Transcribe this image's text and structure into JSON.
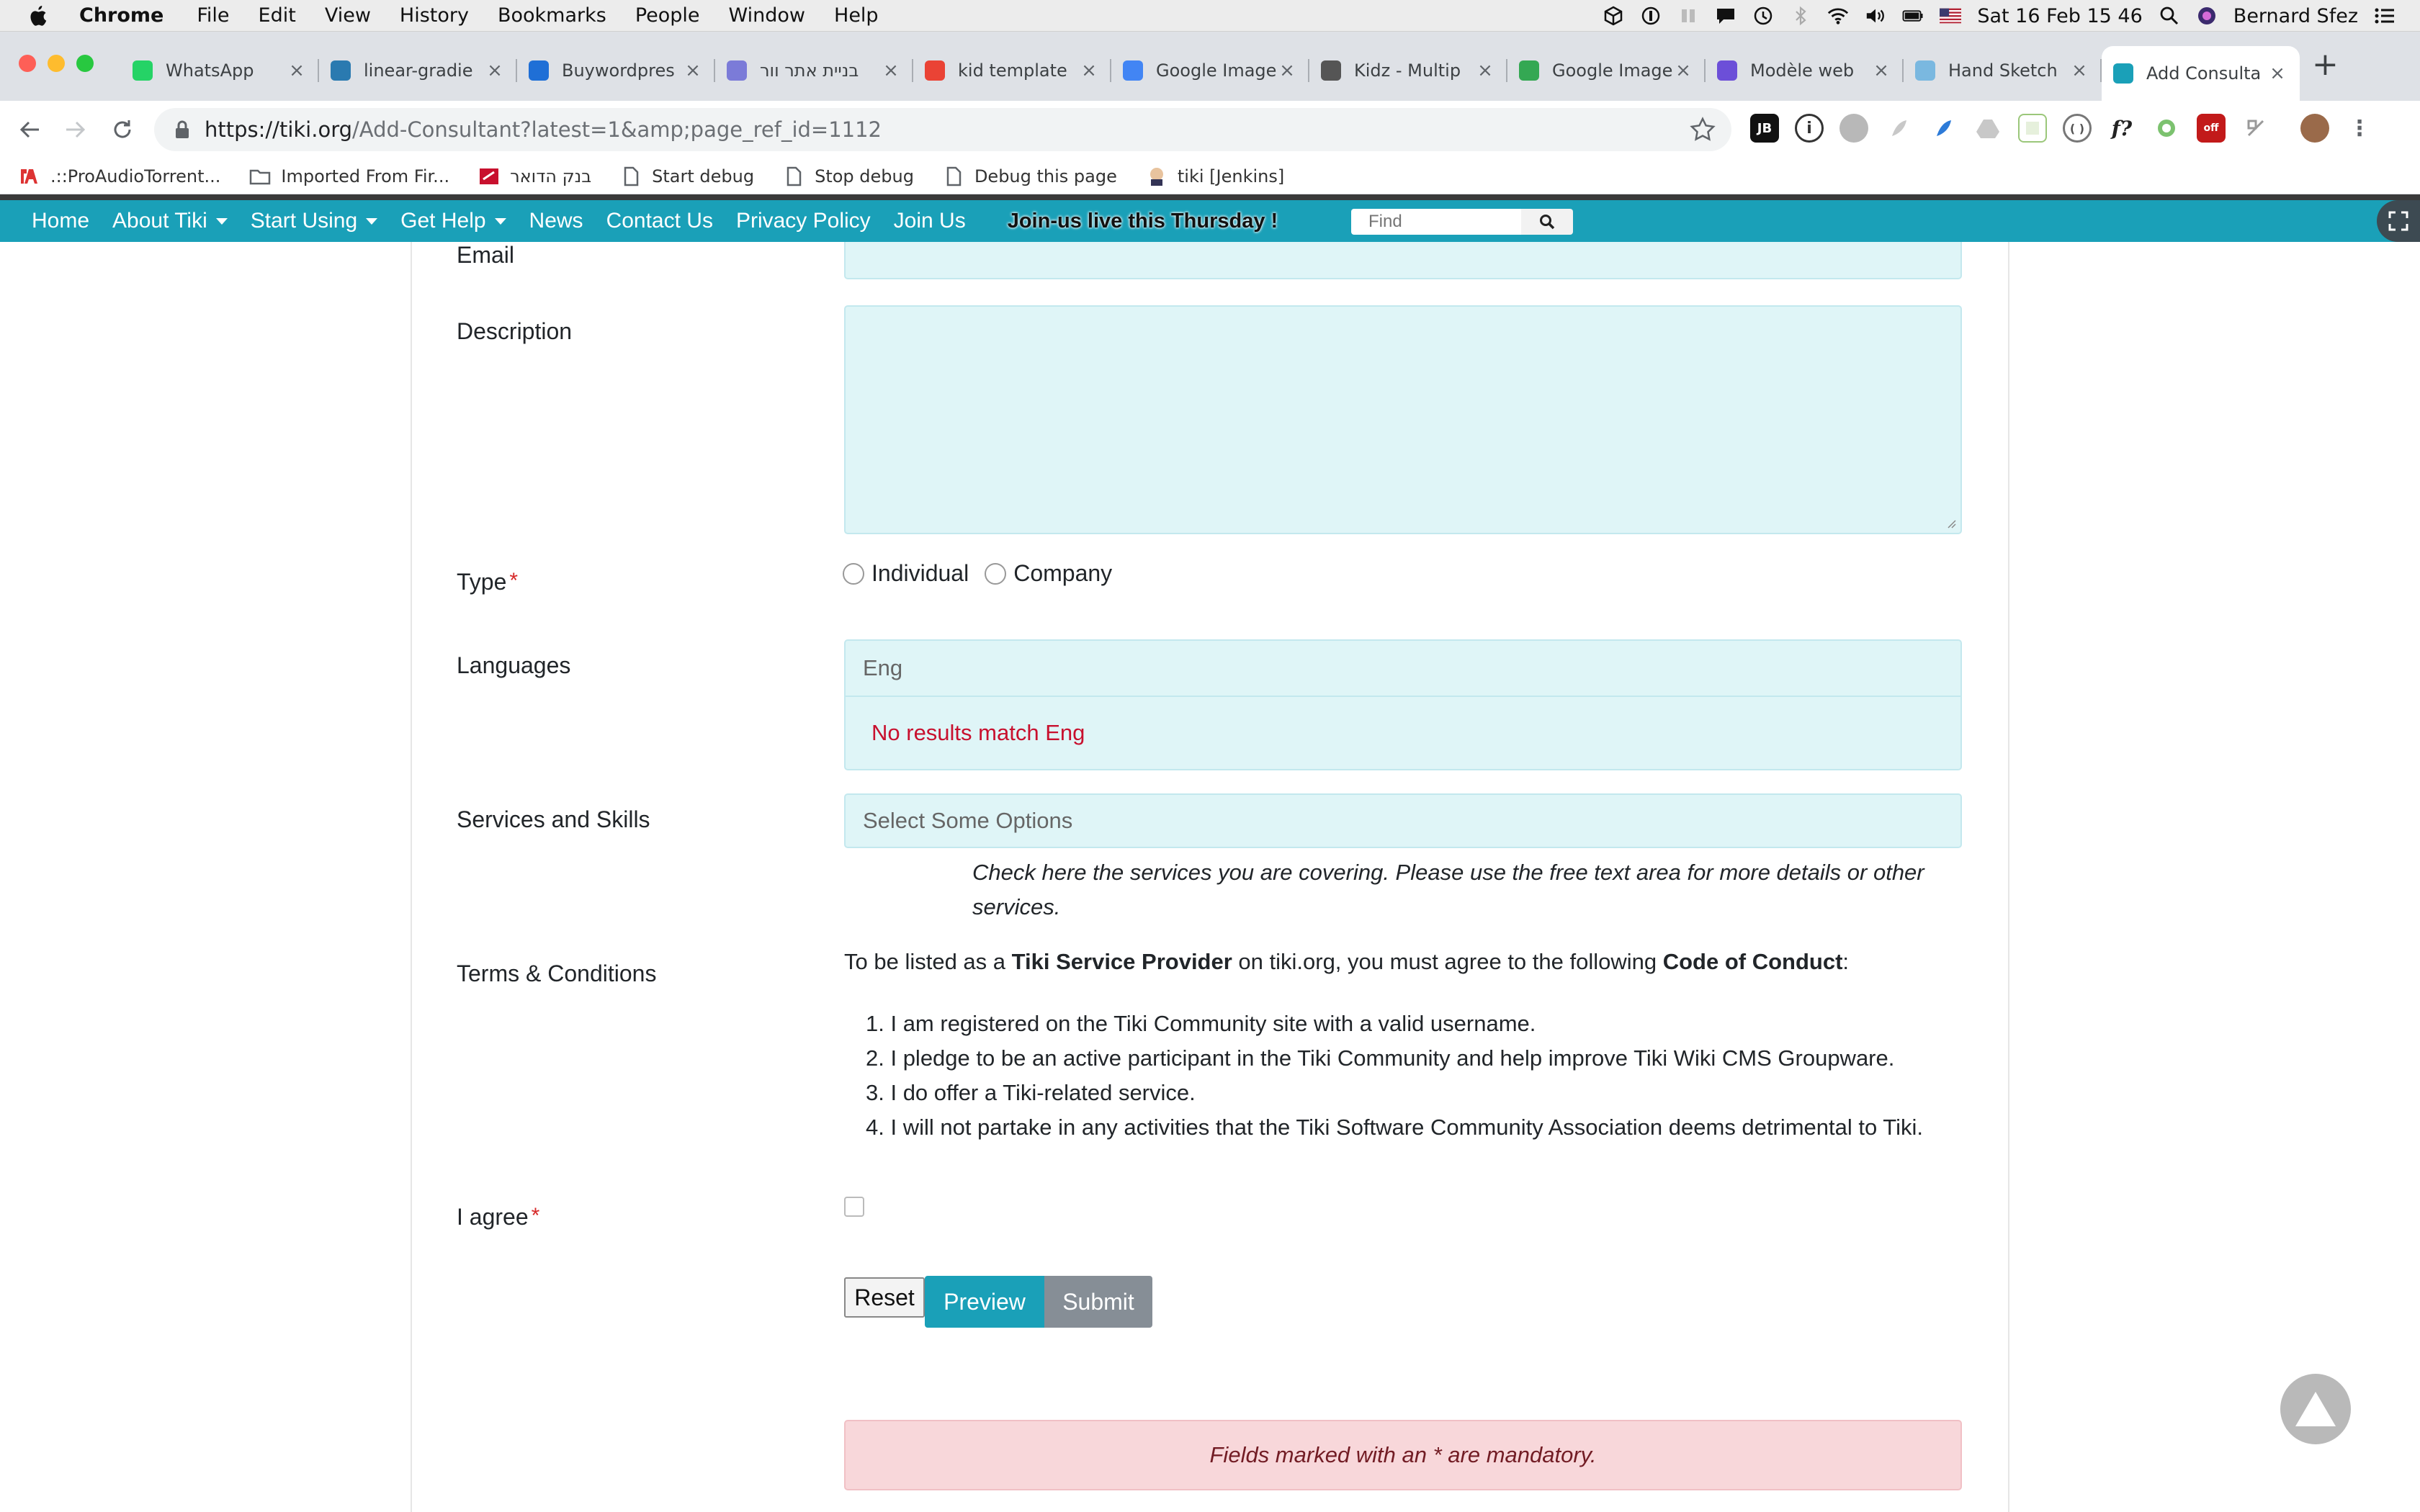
{
  "mac_menubar": {
    "app_name": "Chrome",
    "menus": [
      "File",
      "Edit",
      "View",
      "History",
      "Bookmarks",
      "People",
      "Window",
      "Help"
    ],
    "datetime": "Sat 16 Feb  15 46",
    "user": "Bernard Sfez"
  },
  "browser": {
    "tabs": [
      {
        "title": "WhatsApp",
        "icon": "whatsapp-icon",
        "color": "#25d366"
      },
      {
        "title": "linear-gradie",
        "icon": "site-icon",
        "color": "#2a7ab0"
      },
      {
        "title": "Buywordpres",
        "icon": "feather-icon",
        "color": "#1f6fd6"
      },
      {
        "title": "בניית אתר וור",
        "icon": "rocket-icon",
        "color": "#7b7bd8"
      },
      {
        "title": "kid template",
        "icon": "google-icon",
        "color": "#ea4335"
      },
      {
        "title": "Google Image",
        "icon": "google-icon",
        "color": "#4285f4"
      },
      {
        "title": "Kidz - Multip",
        "icon": "wordpress-icon",
        "color": "#555555"
      },
      {
        "title": "Google Image",
        "icon": "google-icon",
        "color": "#34a853"
      },
      {
        "title": "Modèle web",
        "icon": "template-icon",
        "color": "#6c4fd8"
      },
      {
        "title": "Hand Sketch",
        "icon": "image-icon",
        "color": "#7ab8e0"
      },
      {
        "title": "Add Consulta",
        "icon": "tiki-icon",
        "color": "#1aa0b8",
        "active": true
      }
    ],
    "url_host": "https://tiki.org",
    "url_path": "/Add-Consultant?latest=1&amp;page_ref_id=1112",
    "bookmarks": [
      {
        "label": ".::ProAudioTorrent...",
        "icon": "pat-icon"
      },
      {
        "label": "Imported From Fir...",
        "icon": "folder-icon"
      },
      {
        "label": "בנק הדואר",
        "icon": "bank-icon"
      },
      {
        "label": "Start debug",
        "icon": "page-icon"
      },
      {
        "label": "Stop debug",
        "icon": "page-icon"
      },
      {
        "label": "Debug this page",
        "icon": "page-icon"
      },
      {
        "label": "tiki [Jenkins]",
        "icon": "jenkins-icon"
      }
    ]
  },
  "site_nav": {
    "items": [
      {
        "label": "Home",
        "dropdown": false
      },
      {
        "label": "About Tiki",
        "dropdown": true
      },
      {
        "label": "Start Using",
        "dropdown": true
      },
      {
        "label": "Get Help",
        "dropdown": true
      },
      {
        "label": "News",
        "dropdown": false
      },
      {
        "label": "Contact Us",
        "dropdown": false
      },
      {
        "label": "Privacy Policy",
        "dropdown": false
      },
      {
        "label": "Join Us",
        "dropdown": false
      }
    ],
    "promo": "Join-us live this Thursday !",
    "search_placeholder": "Find",
    "accent": "#1aa0b8"
  },
  "form": {
    "email_label": "Email",
    "description_label": "Description",
    "type_label": "Type",
    "type_options": [
      "Individual",
      "Company"
    ],
    "languages_label": "Languages",
    "languages_value": "Eng",
    "languages_no_results": "No results match Eng",
    "services_label": "Services and Skills",
    "services_placeholder": "Select Some Options",
    "services_help": "Check here the services you are covering. Please use the free text area for more details or other services.",
    "terms_label": "Terms & Conditions",
    "terms_intro_1": "To be listed as a ",
    "terms_intro_b1": "Tiki Service Provider",
    "terms_intro_2": " on tiki.org, you must agree to the following ",
    "terms_intro_b2": "Code of Conduct",
    "terms_intro_3": ":",
    "terms_items": [
      "1. I am registered on the Tiki Community site with a valid username.",
      "2. I pledge to be an active participant in the Tiki Community and help improve Tiki Wiki CMS Groupware.",
      "3. I do offer a Tiki-related service.",
      "4. I will not partake in any activities that the Tiki Software Community Association deems detrimental to Tiki."
    ],
    "agree_label": "I agree",
    "required_mark": "*",
    "reset_label": "Reset",
    "preview_label": "Preview",
    "submit_label": "Submit",
    "mandatory_note": "Fields marked with an * are mandatory."
  }
}
